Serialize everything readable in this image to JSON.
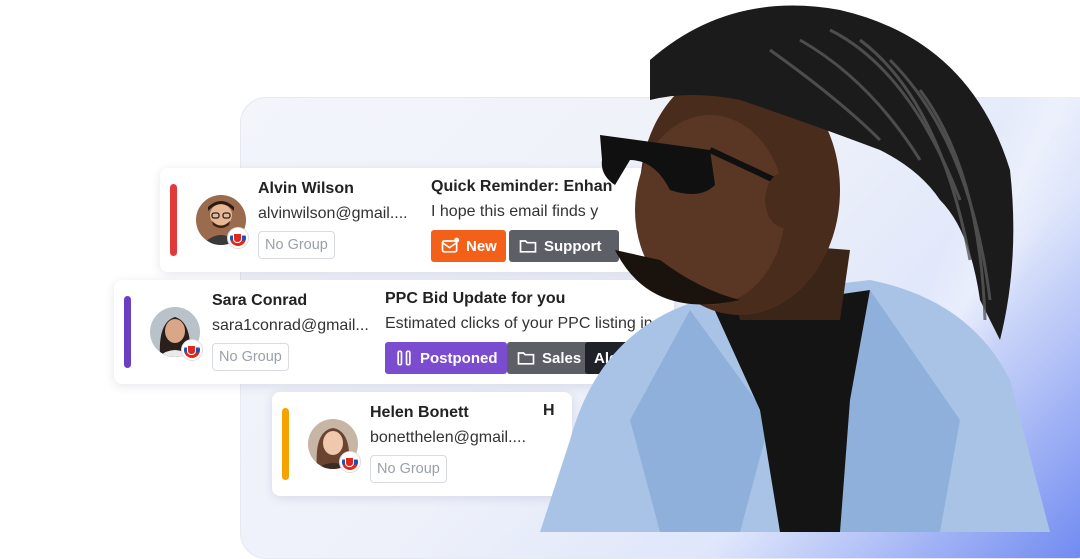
{
  "cards": [
    {
      "name": "Alvin Wilson",
      "email": "alvinwilson@gmail....",
      "group": "No Group",
      "subject": "Quick Reminder: Enhan",
      "snippet": "I hope this email finds y",
      "status_tag": "New",
      "folder_tag": "Support",
      "bar_color": "#e03a3a",
      "status_color": "#f2601a"
    },
    {
      "name": "Sara Conrad",
      "email": "sara1conrad@gmail...",
      "group": "No Group",
      "subject": "PPC Bid Update for you",
      "snippet": "Estimated clicks of your PPC listing in G",
      "status_tag": "Postponed",
      "folder_tag": "Sales",
      "assignee_tag": "Alex Sunn",
      "bar_color": "#6a3fc1",
      "status_color": "#7b4ccf"
    },
    {
      "name": "Helen Bonett",
      "email": "bonetthelen@gmail....",
      "group": "No Group",
      "subject": "H",
      "bar_color": "#f4a300"
    }
  ],
  "icons": {
    "mail": "mail-star-icon",
    "folder": "folder-icon",
    "pause": "pause-icon",
    "flag": "slovakia-flag-icon"
  }
}
